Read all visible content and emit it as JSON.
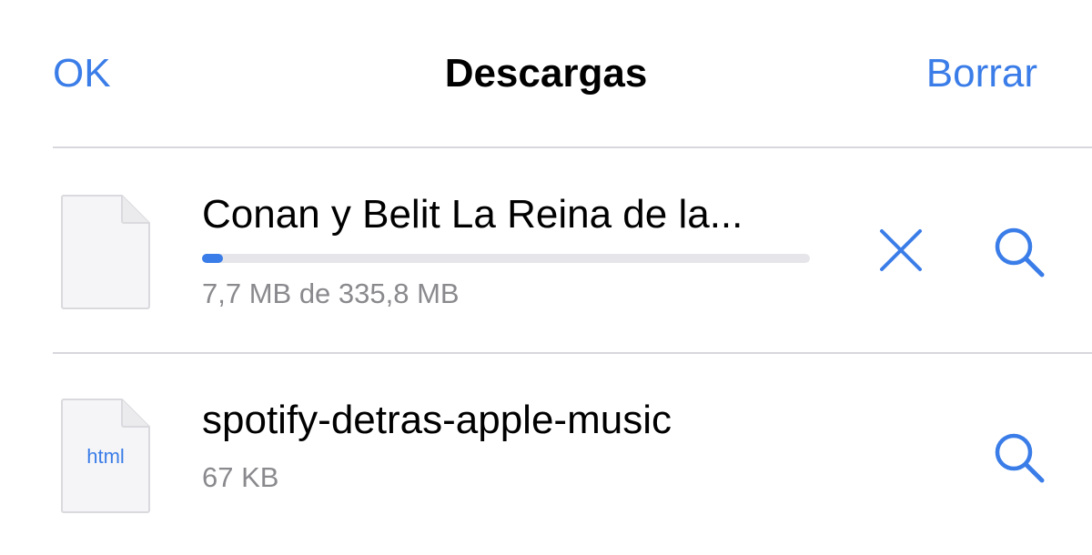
{
  "header": {
    "left_button": "OK",
    "title": "Descargas",
    "right_button": "Borrar"
  },
  "downloads": [
    {
      "title": "Conan y Belit La Reina de la...",
      "status": "7,7 MB de 335,8 MB",
      "progress": 0.023,
      "icon": "file-icon",
      "file_type_label": "",
      "actions": [
        "close-icon",
        "magnifier-icon"
      ]
    },
    {
      "title": "spotify-detras-apple-music",
      "status": "67 KB",
      "icon": "html-file-icon",
      "file_type_label": "html",
      "actions": [
        "magnifier-icon"
      ]
    }
  ],
  "colors": {
    "accent": "#3b7de8",
    "secondary_text": "#8a8a8e",
    "separator": "#d8d8dc"
  }
}
